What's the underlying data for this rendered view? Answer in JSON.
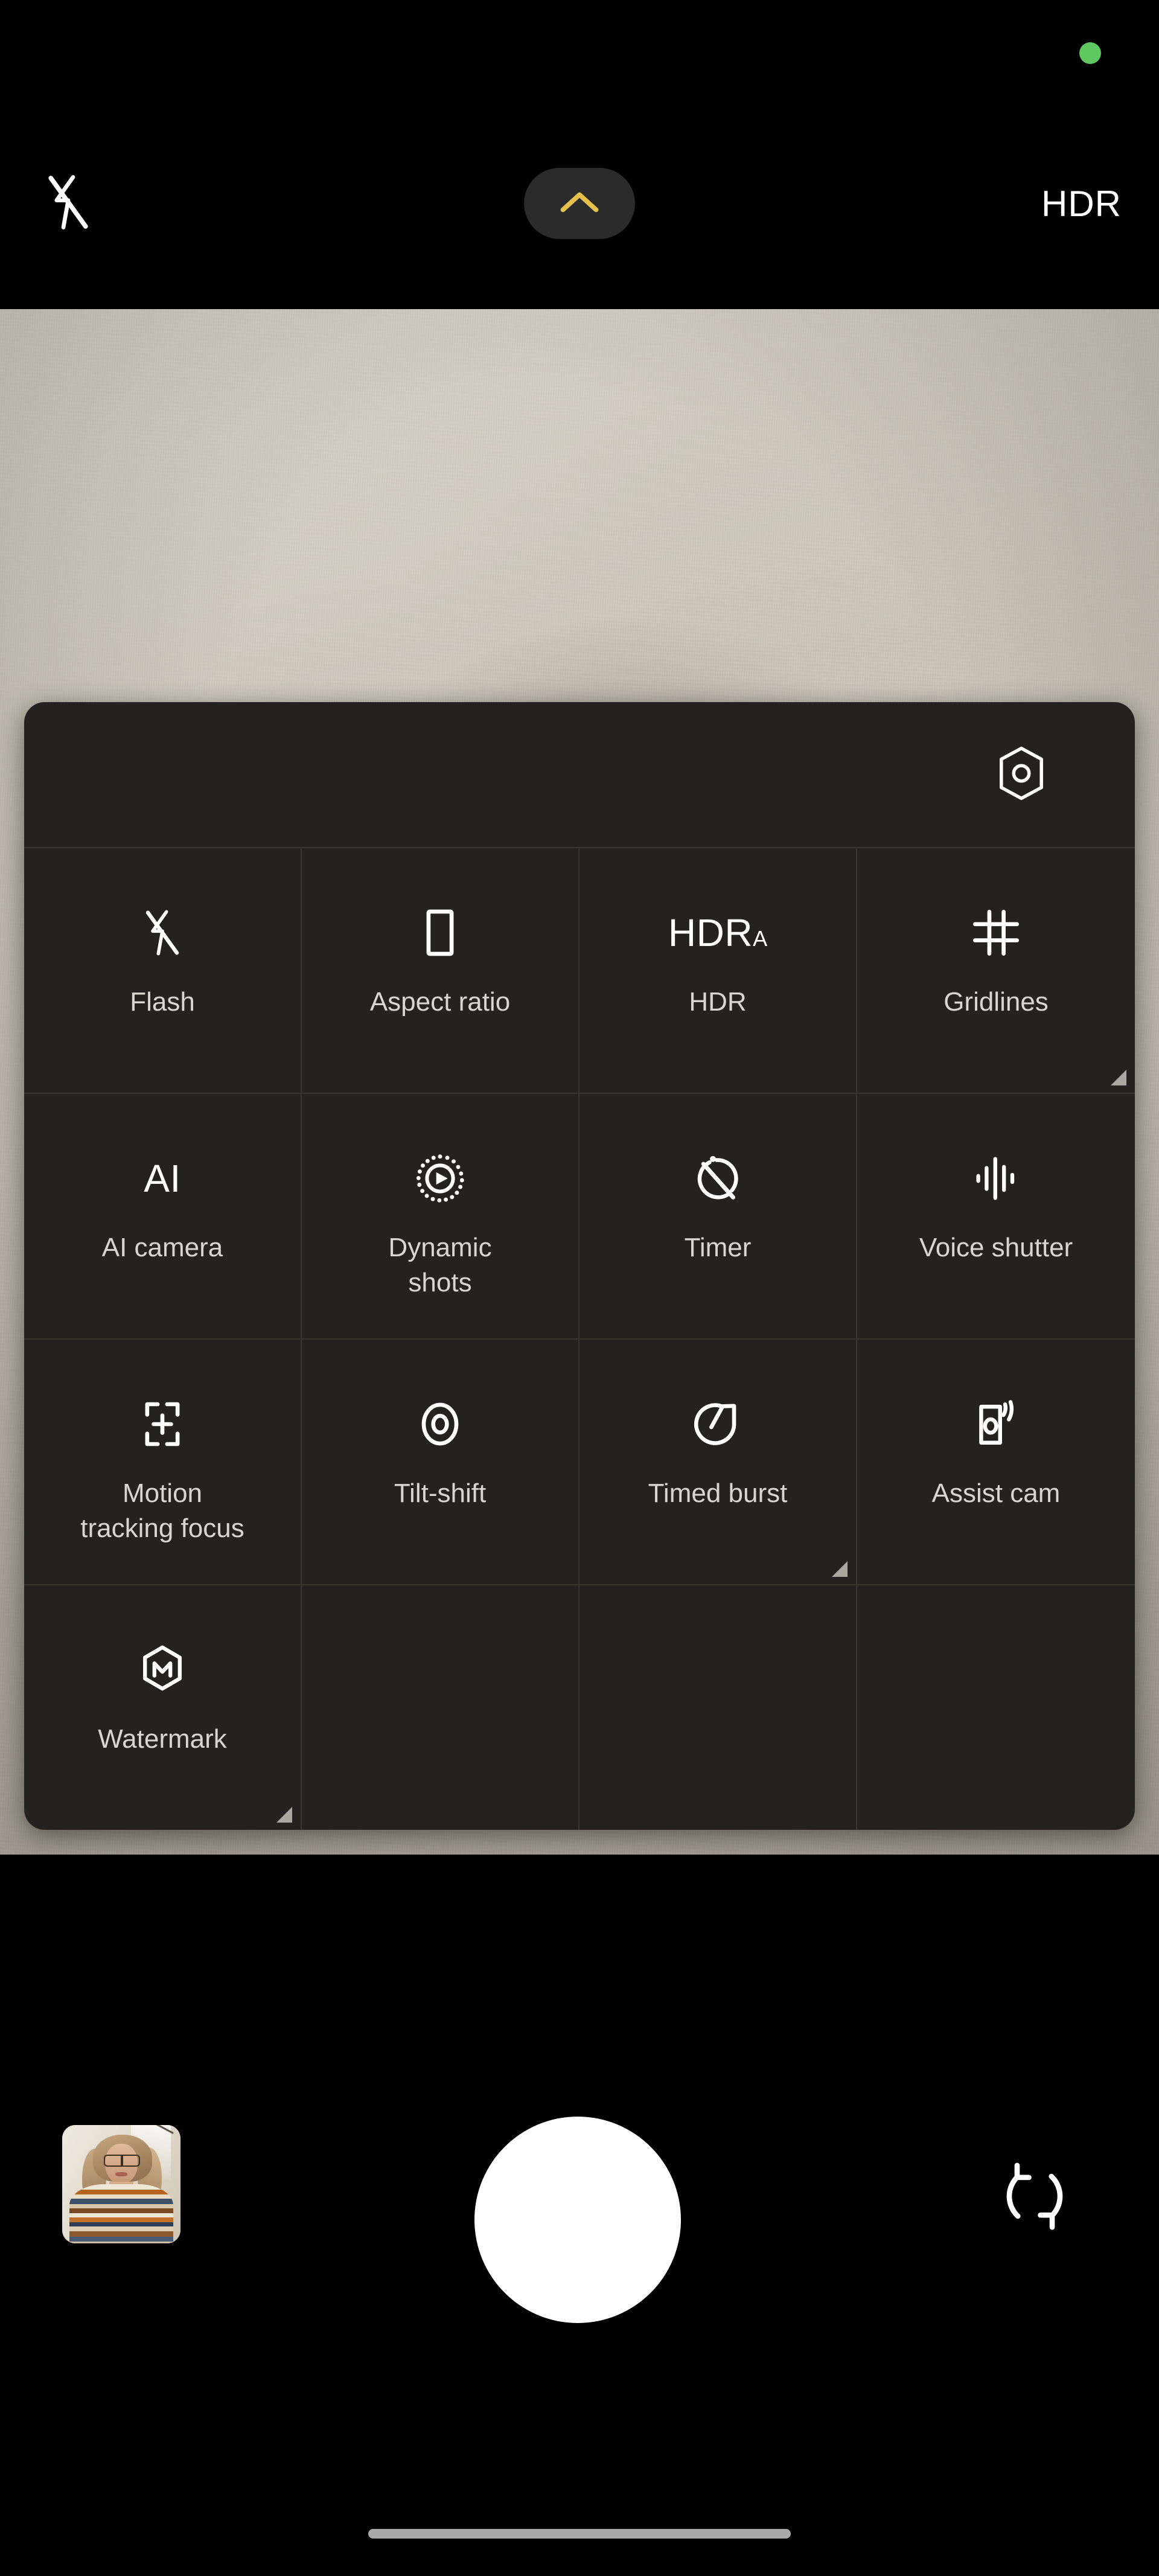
{
  "top_bar": {
    "privacy_indicator": {
      "name": "camera-in-use-dot",
      "color": "#5ec95e"
    },
    "flash": {
      "icon": "flash-off-icon",
      "state": "off"
    },
    "mode_pill": {
      "icon": "chevron-up-icon",
      "color": "#e5c04a",
      "background": "#2b2b2b"
    },
    "hdr_label": "HDR"
  },
  "preview": {
    "description": "live camera preview showing a plain beige wall with a soft shadow",
    "base_color": "#c6bfb1"
  },
  "settings_panel": {
    "header": {
      "settings_icon": "hexagon-aperture-settings-icon"
    },
    "items": [
      {
        "label": "Flash",
        "icon": "flash-off-icon",
        "icon_kind": "svg",
        "corner_marker": false
      },
      {
        "label": "Aspect ratio",
        "icon": "aspect-ratio-portrait-icon",
        "icon_kind": "svg",
        "corner_marker": false
      },
      {
        "label": "HDR",
        "icon": "hdr-auto-icon",
        "icon_kind": "text",
        "icon_text": "HDR",
        "icon_text_sub": "A",
        "corner_marker": false
      },
      {
        "label": "Gridlines",
        "icon": "gridlines-icon",
        "icon_kind": "svg",
        "corner_marker": true
      },
      {
        "label": "AI camera",
        "icon": "ai-camera-icon",
        "icon_kind": "text",
        "icon_text": "AI",
        "icon_text_sub": "",
        "corner_marker": false
      },
      {
        "label": "Dynamic\nshots",
        "icon": "dynamic-shots-icon",
        "icon_kind": "svg",
        "corner_marker": false
      },
      {
        "label": "Timer",
        "icon": "timer-off-icon",
        "icon_kind": "svg",
        "corner_marker": false
      },
      {
        "label": "Voice shutter",
        "icon": "voice-shutter-waveform-icon",
        "icon_kind": "svg",
        "corner_marker": false
      },
      {
        "label": "Motion\ntracking focus",
        "icon": "motion-tracking-focus-icon",
        "icon_kind": "svg",
        "corner_marker": false
      },
      {
        "label": "Tilt-shift",
        "icon": "tilt-shift-icon",
        "icon_kind": "svg",
        "corner_marker": false
      },
      {
        "label": "Timed burst",
        "icon": "timed-burst-icon",
        "icon_kind": "svg",
        "corner_marker": true
      },
      {
        "label": "Assist cam",
        "icon": "assist-cam-icon",
        "icon_kind": "svg",
        "corner_marker": false
      },
      {
        "label": "Watermark",
        "icon": "watermark-hexagon-m-icon",
        "icon_kind": "svg",
        "corner_marker": true
      }
    ]
  },
  "bottom_bar": {
    "gallery_thumbnail": {
      "name": "gallery-thumbnail",
      "description": "portrait photo of a person with glasses in a striped sweater"
    },
    "shutter": {
      "name": "shutter-button",
      "color": "#ffffff"
    },
    "camera_flip": {
      "name": "camera-flip-icon"
    },
    "home_indicator": {
      "name": "home-indicator",
      "color": "#a8a8a8"
    }
  },
  "colors": {
    "panel_background": "#232220",
    "panel_divider": "#37352f",
    "label_text": "#d8d6d2",
    "accent_amber": "#e5c04a",
    "privacy_green": "#5ec95e"
  }
}
